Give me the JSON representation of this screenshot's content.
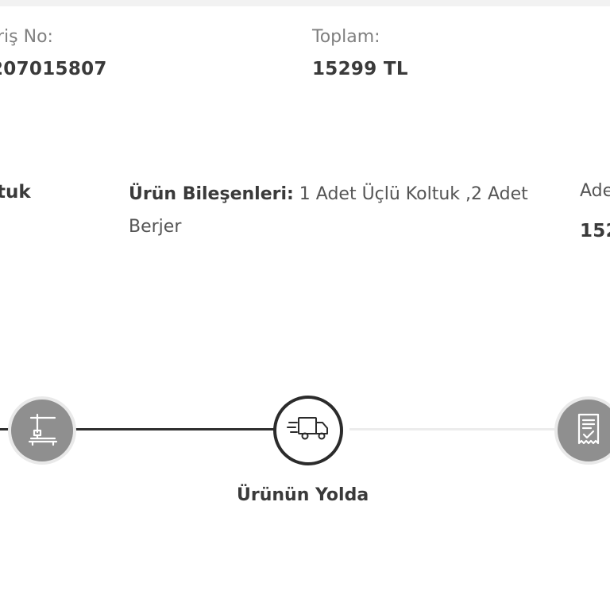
{
  "order": {
    "order_no_label": "riş No:",
    "order_no_value": "207015807",
    "total_label": "Toplam:",
    "total_value": "15299 TL"
  },
  "product": {
    "name_partial": "tuk",
    "components_label": "Ürün Bileşenleri:",
    "components_value": " 1 Adet Üçlü Koltuk ,2 Adet Berjer",
    "right_label_partial": "Ade",
    "right_value_partial": "152"
  },
  "progress": {
    "active_step_label": "Ürünün Yolda",
    "steps": [
      {
        "icon": "production-icon",
        "state": "done"
      },
      {
        "icon": "delivery-truck-icon",
        "state": "active"
      },
      {
        "icon": "invoice-document-icon",
        "state": "pending"
      }
    ]
  }
}
